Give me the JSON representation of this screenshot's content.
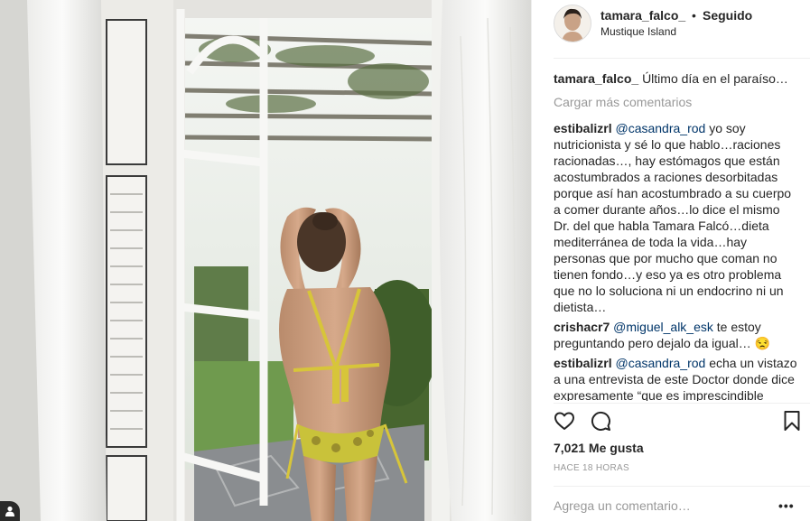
{
  "post": {
    "username": "tamara_falco_",
    "separator": "•",
    "follow_label": "Seguido",
    "location": "Mustique Island",
    "caption_user": "tamara_falco_",
    "caption_text": "Último día en el paraíso…",
    "load_more_label": "Cargar más comentarios",
    "comments": [
      {
        "user": "estibalizrl",
        "mention": "@casandra_rod",
        "text": "yo soy nutricionista y sé lo que hablo…raciones racionadas…, hay estómagos que están acostumbrados a raciones desorbitadas porque así han acostumbrado a su cuerpo a comer durante años…lo dice el mismo Dr. del que habla Tamara Falcó…dieta mediterránea de toda la vida…hay personas que por mucho que coman no tienen fondo…y eso ya es otro problema que no lo soluciona ni un endocrino ni un dietista…"
      },
      {
        "user": "crishacr7",
        "mention": "@miguel_alk_esk",
        "text": "te estoy preguntando pero dejalo da igual… 😒"
      },
      {
        "user": "estibalizrl",
        "mention": "@casandra_rod",
        "text": "echa un vistazo a una entrevista de este Doctor donde dice expresamente “que es imprescindible reducir las cantidades y raciones”…si tu"
      }
    ],
    "likes_label": "7,021 Me gusta",
    "time_label": "HACE 18 HORAS",
    "add_comment_placeholder": "Agrega un comentario…",
    "more_label": "•••"
  },
  "icons": [
    "heart-icon",
    "comment-icon",
    "bookmark-icon",
    "user-tag-icon",
    "more-options-icon"
  ]
}
